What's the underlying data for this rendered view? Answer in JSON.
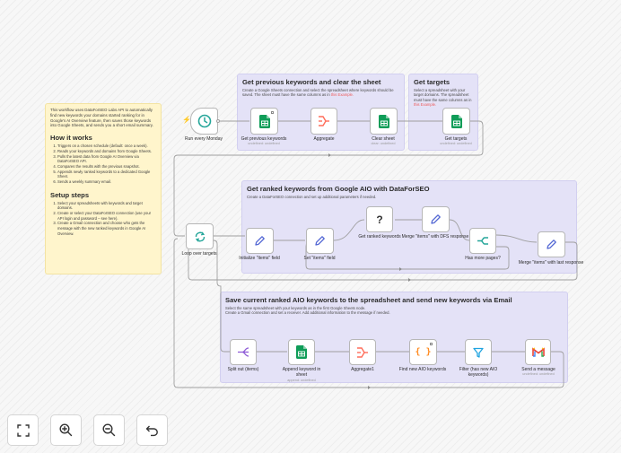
{
  "intro_note": {
    "description": "This workflow uses DataForSEO Labs API to automatically find new keywords your domains started ranking for in Google's AI Overview feature, then saves those keywords into Google Sheets, and sends you a short email summary.",
    "how_title": "How it works",
    "how_steps": [
      "Triggers on a chosen schedule (default: once a week).",
      "Reads your keywords and domains from Google Sheets.",
      "Pulls the latest data from Google AI Overview via DataForSEO API.",
      "Compares the results with the previous snapshot.",
      "Appends newly ranked keywords to a dedicated Google Sheet.",
      "Sends a weekly summary email."
    ],
    "setup_title": "Setup steps",
    "setup_steps": [
      "Select your spreadsheets with keywords and target domains.",
      "Create or select your DataForSEO connection (use your API login and password – see here).",
      "Create a Gmail connection and choose who gets the message with the new ranked keywords in Google AI Overview."
    ]
  },
  "sections": {
    "prev": {
      "title": "Get previous keywords and clear the sheet",
      "desc": "Create a Google Sheets connection and select the spreadsheet where keywords should be saved. The sheet must have the same columns as in",
      "link": "this Example."
    },
    "targets": {
      "title": "Get targets",
      "desc": "Select a spreadsheet with your target domains. The spreadsheet must have the same columns as in",
      "link": "this Example."
    },
    "ranked": {
      "title": "Get ranked keywords from Google AIO with DataForSEO",
      "desc": "Create a DataForSEO connection and set up additional parameters if needed."
    },
    "save": {
      "title": "Save current ranked AIO keywords to the spreadsheet and send new keywords via Email",
      "desc1": "Select the same spreadsheet with your keywords as in the first Google Sheets node.",
      "desc2": "Create a Gmail connection and set a receiver. Add additional information to the message if needed."
    }
  },
  "nodes": {
    "run_monday": {
      "label": "Run every Monday"
    },
    "get_prev": {
      "label": "Get previous keywords",
      "sub": "undefined: undefined"
    },
    "aggregate": {
      "label": "Aggregate"
    },
    "clear_sheet": {
      "label": "Clear sheet",
      "sub": "clear: undefined"
    },
    "get_targets": {
      "label": "Get targets",
      "sub": "undefined: undefined"
    },
    "loop": {
      "label": "Loop over targets"
    },
    "init_items": {
      "label": "Initialize \"items\" field"
    },
    "set_items": {
      "label": "Set \"items\" field"
    },
    "get_ranked": {
      "label": "Get ranked keywords",
      "icon_text": "?"
    },
    "merge_dfs": {
      "label": "Merge \"items\" with DFS response"
    },
    "has_more": {
      "label": "Has more pages?"
    },
    "merge_last": {
      "label": "Merge \"items\" with last response"
    },
    "split_out": {
      "label": "Split out (items)"
    },
    "append": {
      "label": "Append keyword in sheet",
      "sub": "append: undefined"
    },
    "aggregate1": {
      "label": "Aggregate1"
    },
    "find_new": {
      "label": "Find new AIO keywords",
      "icon_text": "{ }"
    },
    "filter": {
      "label": "Filter (has new AIO keywords)"
    },
    "send": {
      "label": "Send a message",
      "sub": "undefined: undefined"
    }
  },
  "controls": [
    {
      "name": "fit-view",
      "icon": "expand-icon"
    },
    {
      "name": "zoom-in",
      "icon": "zoom-in-icon"
    },
    {
      "name": "zoom-out",
      "icon": "zoom-out-icon"
    },
    {
      "name": "undo",
      "icon": "undo-icon"
    }
  ],
  "colors": {
    "sheets_green": "#0f9d58",
    "aggregate_orange": "#ff6d5a",
    "edit_blue": "#5468d4",
    "purple_note": "#e4e2f7",
    "yellow_note": "#fff5cc",
    "trigger_teal": "#26a69a"
  }
}
